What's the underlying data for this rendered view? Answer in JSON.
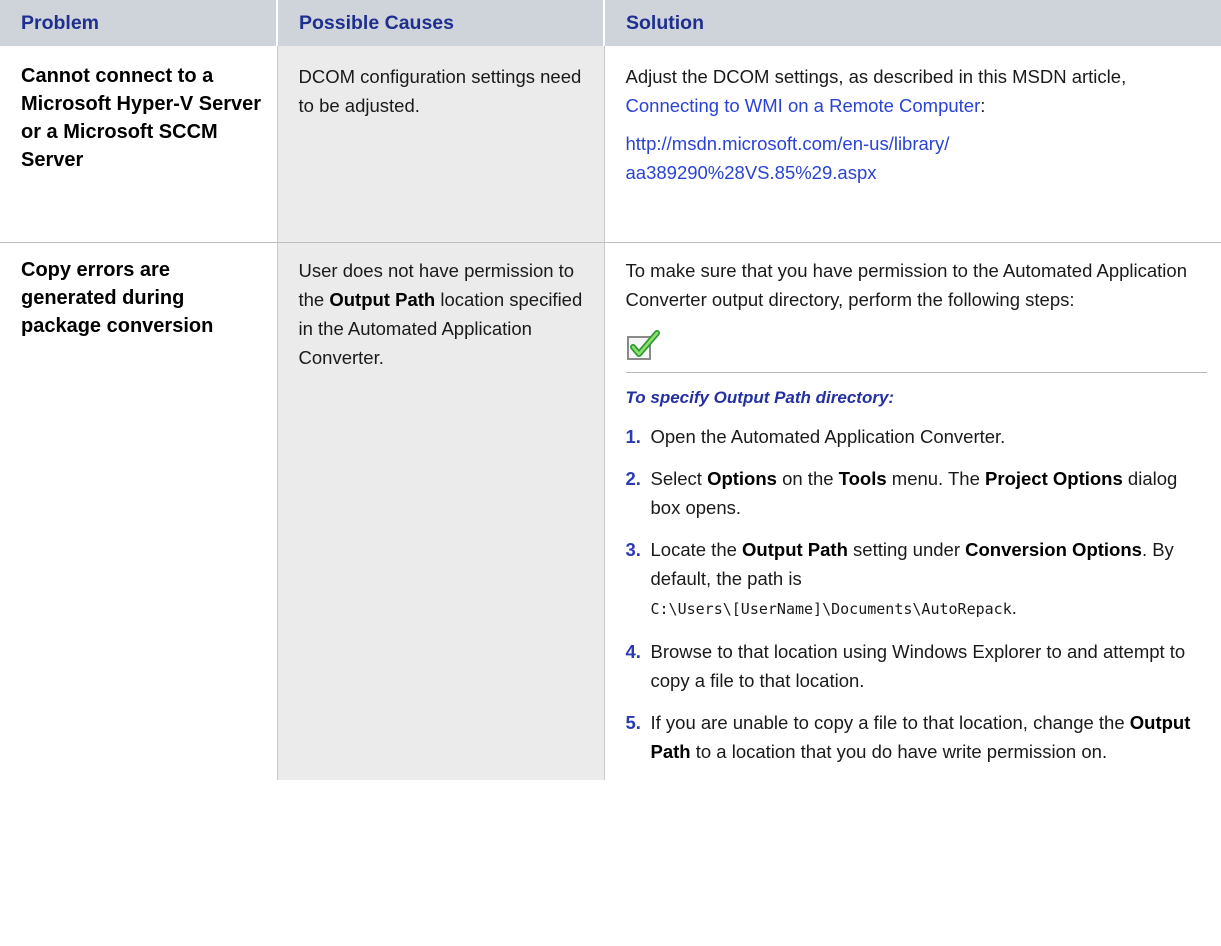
{
  "headers": {
    "problem": "Problem",
    "causes": "Possible Causes",
    "solution": "Solution"
  },
  "row1": {
    "problem": "Cannot connect to a Microsoft Hyper-V Server or a Microsoft SCCM Server",
    "cause": "DCOM configuration settings need to be adjusted.",
    "solution_pre": "Adjust the DCOM settings, as described in this MSDN article, ",
    "solution_link": "Connecting to WMI on a Remote Computer",
    "solution_post": ":",
    "url_line1": "http://msdn.microsoft.com/en-us/library/",
    "url_line2": "aa389290%28VS.85%29.aspx"
  },
  "row2": {
    "problem": "Copy errors are generated during package conversion",
    "cause_a": "User does not have permission to the ",
    "cause_bold": "Output Path",
    "cause_b": " location specified in the Automated Application Converter.",
    "solution_intro": "To make sure that you have permission to the Automated Application Converter output directory, perform the following steps:",
    "procedure_title": "To specify Output Path directory:",
    "steps": [
      {
        "num": "1.",
        "text": "Open the Automated Application Converter."
      },
      {
        "num": "2.",
        "t1": "Select ",
        "b1": "Options",
        "t2": " on the ",
        "b2": "Tools",
        "t3": " menu. The ",
        "b3": "Project Options",
        "t4": " dialog box opens."
      },
      {
        "num": "3.",
        "t1": "Locate the ",
        "b1": "Output Path",
        "t2": " setting under ",
        "b2": "Conversion Options",
        "t3": ". By default, the path is ",
        "code": "C:\\Users\\[UserName]\\Documents\\AutoRepack",
        "t4": "."
      },
      {
        "num": "4.",
        "text": "Browse to that location using Windows Explorer to and attempt to copy a file to that location."
      },
      {
        "num": "5.",
        "t1": "If you are unable to copy a file to that location, change the ",
        "b1": "Output Path",
        "t2": " to a location that you do have write permission on."
      }
    ]
  },
  "icon": "checkmark-box-icon",
  "colors": {
    "header_bg": "#cfd3da",
    "header_text": "#1f2f8f",
    "cause_bg": "#ebebeb",
    "link": "#2a43d4",
    "step_number": "#2a3bb4"
  }
}
